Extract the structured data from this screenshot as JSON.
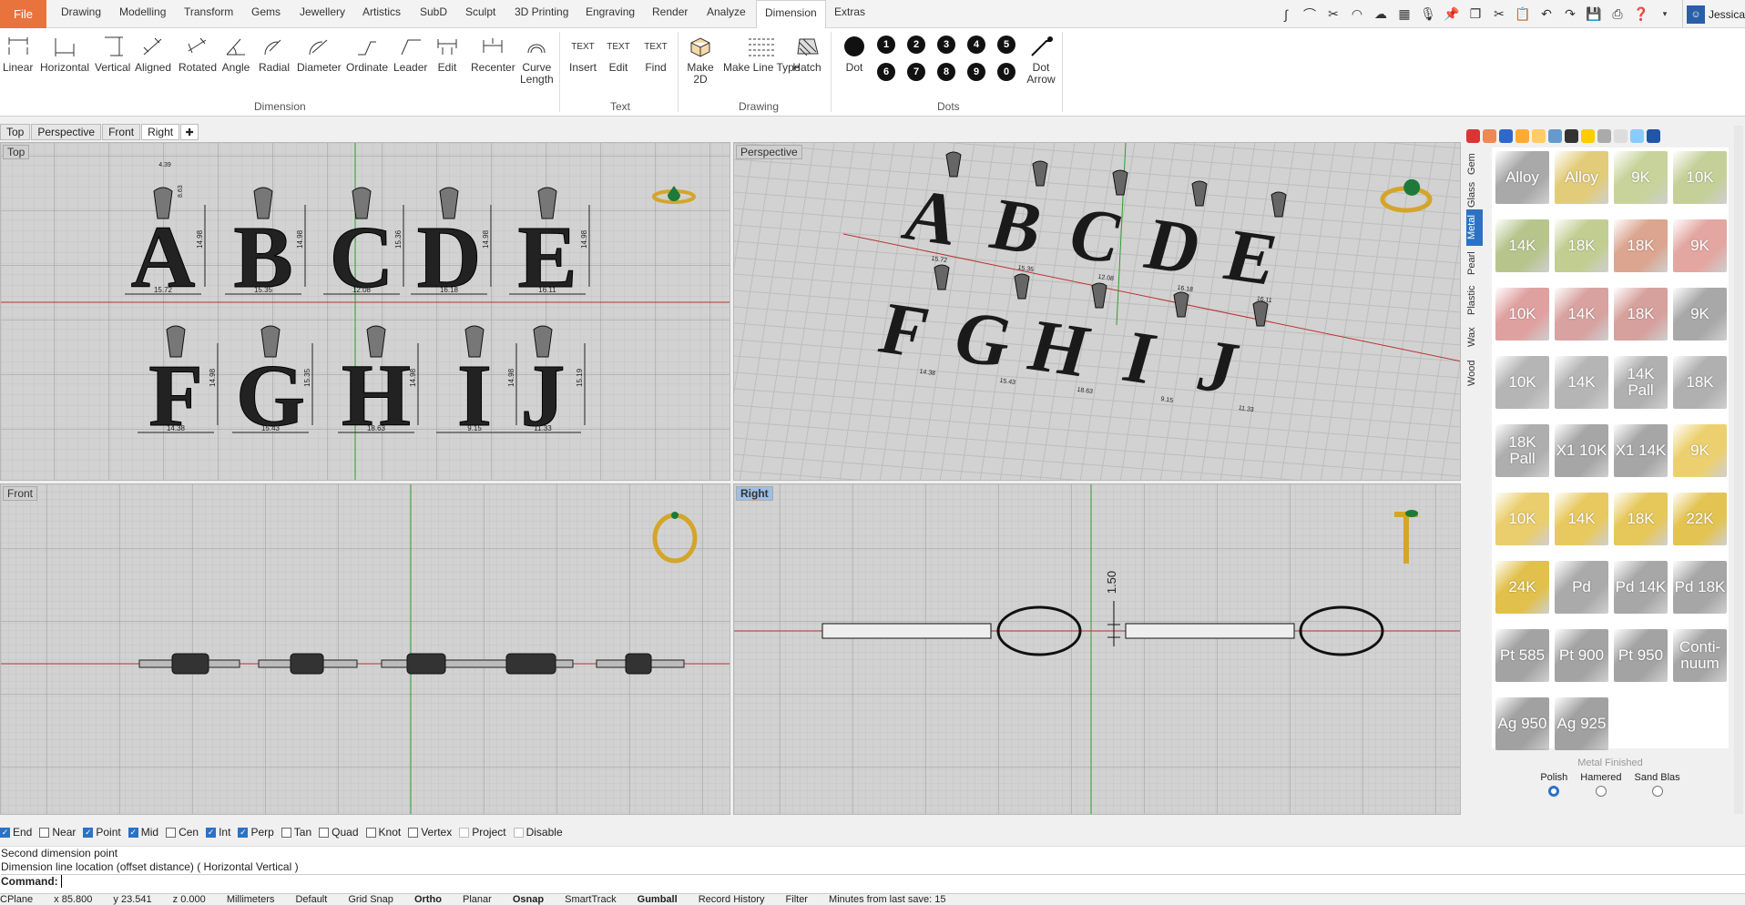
{
  "menu": {
    "file": "File",
    "tabs": [
      "Drawing",
      "Modelling",
      "Transform",
      "Gems",
      "Jewellery",
      "Artistics",
      "SubD",
      "Sculpt",
      "3D Printing",
      "Engraving",
      "Render",
      "Analyze",
      "Dimension",
      "Extras"
    ],
    "active_tab": "Dimension",
    "user": "Jessica"
  },
  "ribbon": {
    "dimension_group": "Dimension",
    "text_group": "Text",
    "drawing_group": "Drawing",
    "dots_group": "Dots",
    "buttons": {
      "linear": "Linear",
      "horizontal": "Horizontal",
      "vertical": "Vertical",
      "aligned": "Aligned",
      "rotated": "Rotated",
      "angle": "Angle",
      "radial": "Radial",
      "diameter": "Diameter",
      "ordinate": "Ordinate",
      "leader": "Leader",
      "edit": "Edit",
      "recenter": "Recenter",
      "curve_length_1": "Curve",
      "curve_length_2": "Length",
      "insert": "Insert",
      "text_edit": "Edit",
      "find": "Find",
      "text_icon": "TEXT",
      "make2d_1": "Make",
      "make2d_2": "2D",
      "make_line_type": "Make Line Type",
      "hatch": "Hatch",
      "dot": "Dot",
      "dot_arrow_1": "Dot",
      "dot_arrow_2": "Arrow"
    },
    "dots_numbers": [
      "1",
      "2",
      "3",
      "4",
      "5",
      "6",
      "7",
      "8",
      "9",
      "0"
    ]
  },
  "viewport_tabs": [
    "Top",
    "Perspective",
    "Front",
    "Right"
  ],
  "active_viewport_tab": "Right",
  "viewports": {
    "top": {
      "label": "Top"
    },
    "perspective": {
      "label": "Perspective"
    },
    "front": {
      "label": "Front"
    },
    "right": {
      "label": "Right",
      "dimension": "1.50"
    }
  },
  "top_letters_row1": [
    {
      "letter": "A",
      "width": "15.72",
      "height": "14.98"
    },
    {
      "letter": "B",
      "width": "15.35",
      "height": "14.98"
    },
    {
      "letter": "C",
      "width": "12.08",
      "height": "15.36"
    },
    {
      "letter": "D",
      "width": "16.18",
      "height": "14.98"
    },
    {
      "letter": "E",
      "width": "16.11",
      "height": "14.98"
    }
  ],
  "top_letters_row2": [
    {
      "letter": "F",
      "width": "14.38",
      "height": "14.98"
    },
    {
      "letter": "G",
      "width": "15.43",
      "height": "15.35"
    },
    {
      "letter": "H",
      "width": "18.63",
      "height": "14.98"
    },
    {
      "letter": "I",
      "width": "9.15",
      "height": "14.98"
    },
    {
      "letter": "J",
      "width": "11.33",
      "height": "15.19"
    }
  ],
  "bail_dims": {
    "width": "4.39",
    "height": "8.63"
  },
  "panel": {
    "vtabs": [
      "Gem",
      "Glass",
      "Metal",
      "Pearl",
      "Plastic",
      "Wax",
      "Wood"
    ],
    "active_vtab": "Metal",
    "swatches": [
      {
        "label": "Alloy",
        "color": "#a9a9a9"
      },
      {
        "label": "Alloy",
        "color": "#e2cc7a"
      },
      {
        "label": "9K",
        "color": "#c7d39a"
      },
      {
        "label": "10K",
        "color": "#c5cf98"
      },
      {
        "label": "14K",
        "color": "#b7c58d"
      },
      {
        "label": "18K",
        "color": "#c2cd92"
      },
      {
        "label": "18K",
        "color": "#dba58f"
      },
      {
        "label": "9K",
        "color": "#e3a6a0"
      },
      {
        "label": "10K",
        "color": "#dfa1a0"
      },
      {
        "label": "14K",
        "color": "#d7a2a0"
      },
      {
        "label": "18K",
        "color": "#d6a09c"
      },
      {
        "label": "9K",
        "color": "#a8a8a8"
      },
      {
        "label": "10K",
        "color": "#b5b5b5"
      },
      {
        "label": "14K",
        "color": "#b5b5b5"
      },
      {
        "label": "14K Pall",
        "color": "#b0b0b0"
      },
      {
        "label": "18K",
        "color": "#b0b0b0"
      },
      {
        "label": "18K Pall",
        "color": "#aeaeae"
      },
      {
        "label": "X1 10K",
        "color": "#a6a6a6"
      },
      {
        "label": "X1 14K",
        "color": "#a6a6a6"
      },
      {
        "label": "9K",
        "color": "#ecd070"
      },
      {
        "label": "10K",
        "color": "#eacd6c"
      },
      {
        "label": "14K",
        "color": "#e8c960"
      },
      {
        "label": "18K",
        "color": "#e6c75a"
      },
      {
        "label": "22K",
        "color": "#e3c352"
      },
      {
        "label": "24K",
        "color": "#e1c04c"
      },
      {
        "label": "Pd",
        "color": "#aaaaaa"
      },
      {
        "label": "Pd 14K",
        "color": "#a7a7a7"
      },
      {
        "label": "Pd 18K",
        "color": "#a6a6a6"
      },
      {
        "label": "Pt 585",
        "color": "#a3a3a3"
      },
      {
        "label": "Pt 900",
        "color": "#a3a3a3"
      },
      {
        "label": "Pt 950",
        "color": "#a3a3a3"
      },
      {
        "label": "Conti-nuum",
        "color": "#a5a5a5"
      },
      {
        "label": "Ag 950",
        "color": "#a1a1a1"
      },
      {
        "label": "Ag 925",
        "color": "#a1a1a1"
      }
    ],
    "finish_title": "Metal Finished",
    "finish_options": [
      "Polish",
      "Hamered",
      "Sand Blas"
    ],
    "finish_selected": "Polish"
  },
  "osnaps": [
    {
      "label": "End",
      "on": true
    },
    {
      "label": "Near",
      "on": false
    },
    {
      "label": "Point",
      "on": true
    },
    {
      "label": "Mid",
      "on": true
    },
    {
      "label": "Cen",
      "on": false
    },
    {
      "label": "Int",
      "on": true
    },
    {
      "label": "Perp",
      "on": true
    },
    {
      "label": "Tan",
      "on": false
    },
    {
      "label": "Quad",
      "on": false
    },
    {
      "label": "Knot",
      "on": false
    },
    {
      "label": "Vertex",
      "on": false
    },
    {
      "label": "Project",
      "on": false,
      "dis": true
    },
    {
      "label": "Disable",
      "on": false,
      "dis": true
    }
  ],
  "command": {
    "line1": "Second dimension point",
    "line2": "Dimension line location (offset distance) ( Horizontal  Vertical )",
    "prompt": "Command:"
  },
  "status": {
    "cplane": "CPlane",
    "x": "x 85.800",
    "y": "y 23.541",
    "z": "z 0.000",
    "units": "Millimeters",
    "layer": "Default",
    "grid_snap": "Grid Snap",
    "ortho": "Ortho",
    "planar": "Planar",
    "osnap": "Osnap",
    "smarttrack": "SmartTrack",
    "gumball": "Gumball",
    "record_history": "Record History",
    "filter": "Filter",
    "save_info": "Minutes from last save: 15"
  },
  "colors": {
    "accent": "#2b72c4",
    "file_tab": "#e8733c",
    "grid_bg": "#d2d2d2",
    "active_vp": "#9cbfe6"
  }
}
